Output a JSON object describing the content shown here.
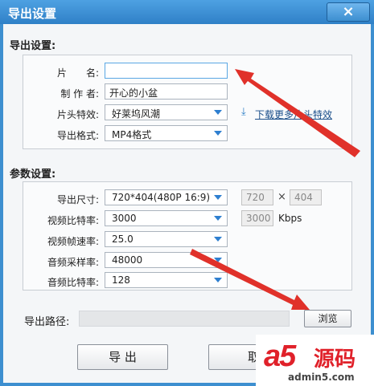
{
  "window": {
    "title": "导出设置",
    "close_glyph": "×"
  },
  "export_section": {
    "title": "导出设置:",
    "clip_name": {
      "label": "片　　名:",
      "value": ""
    },
    "author": {
      "label": "制 作 者:",
      "value": "开心的小盆"
    },
    "intro_effect": {
      "label": "片头特效:",
      "value": "好莱坞风潮"
    },
    "download_link": "下载更多片头特效",
    "output_format": {
      "label": "导出格式:",
      "value": "MP4格式"
    }
  },
  "params_section": {
    "title": "参数设置:",
    "size": {
      "label": "导出尺寸:",
      "value": "720*404(480P 16:9)",
      "width": "720",
      "height": "404",
      "times": "×"
    },
    "video_bitrate": {
      "label": "视频比特率:",
      "value": "3000",
      "custom": "3000",
      "unit": "Kbps"
    },
    "frame_rate": {
      "label": "视频帧速率:",
      "value": "25.0"
    },
    "audio_sample_rate": {
      "label": "音频采样率:",
      "value": "48000"
    },
    "audio_bitrate": {
      "label": "音频比特率:",
      "value": "128"
    }
  },
  "export_path": {
    "label": "导出路径:",
    "value": "",
    "browse_label": "浏览"
  },
  "actions": {
    "export_label": "导 出",
    "cancel_label": "取"
  },
  "watermark": {
    "brand": "a5",
    "brand_cn": "源码",
    "url": "admin5.com"
  },
  "colors": {
    "titlebar": "#2f80c7",
    "annotation_arrow": "#e0312a",
    "accent": "#5aa7e3"
  }
}
